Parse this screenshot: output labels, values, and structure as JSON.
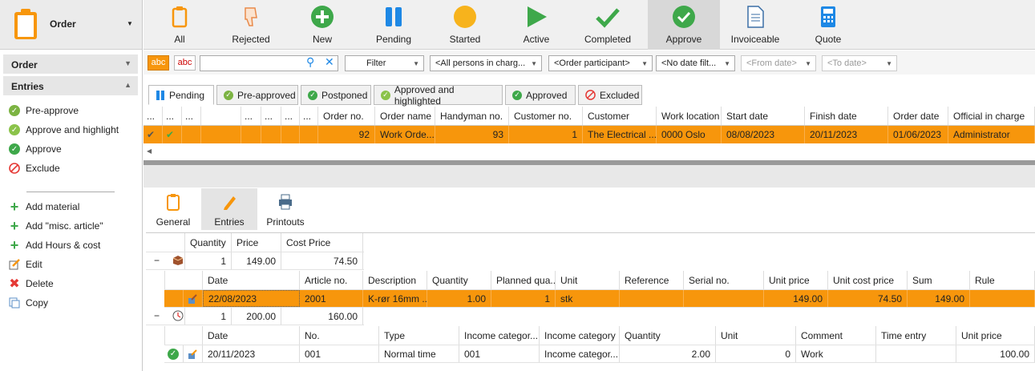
{
  "app": {
    "title": "Order"
  },
  "sidebar": {
    "sections": [
      "Order",
      "Entries"
    ],
    "group1": [
      "Pre-approve",
      "Approve and highlight",
      "Approve",
      "Exclude"
    ],
    "group2": [
      "Add material",
      "Add \"misc. article\"",
      "Add Hours & cost",
      "Edit",
      "Delete",
      "Copy"
    ]
  },
  "toolbar": [
    "All",
    "Rejected",
    "New",
    "Pending",
    "Started",
    "Active",
    "Completed",
    "Approve",
    "Invoiceable",
    "Quote"
  ],
  "filters": {
    "abc1": "abc",
    "abc2": "abc",
    "search": "",
    "filter": "Filter",
    "persons": "<All persons in charg...",
    "participant": "<Order participant>",
    "date_filter": "<No date filt...",
    "from_date": "<From date>",
    "to_date": "<To date>"
  },
  "tabs": [
    "Pending",
    "Pre-approved",
    "Postponed",
    "Approved and highlighted",
    "Approved",
    "Excluded"
  ],
  "orders": {
    "headers": [
      "...",
      "...",
      "...",
      "...",
      "...",
      "...",
      "...",
      "Order no.",
      "Order name",
      "Handyman no.",
      "Customer no.",
      "Customer",
      "Work location",
      "Start date",
      "Finish date",
      "Order date",
      "Official in charge"
    ],
    "row": [
      "92",
      "Work Orde...",
      "93",
      "1",
      "The Electrical ...",
      "0000 Oslo",
      "08/08/2023",
      "20/11/2023",
      "01/06/2023",
      "Administrator"
    ]
  },
  "detail_tabs": [
    "General",
    "Entries",
    "Printouts"
  ],
  "entries": {
    "headers": [
      "Quantity",
      "Price",
      "Cost Price"
    ],
    "material": {
      "quantity": "1",
      "price": "149.00",
      "cost": "74.50"
    },
    "material_headers": [
      "Date",
      "Article no.",
      "Description",
      "Quantity",
      "Planned qua...",
      "Unit",
      "Reference",
      "Serial no.",
      "Unit price",
      "Unit cost price",
      "Sum",
      "Rule"
    ],
    "material_row": [
      "22/08/2023",
      "2001",
      "K-rør 16mm ...",
      "1.00",
      "1",
      "stk",
      "",
      "",
      "149.00",
      "74.50",
      "149.00",
      ""
    ],
    "hours": {
      "quantity": "1",
      "price": "200.00",
      "cost": "160.00"
    },
    "hours_headers": [
      "Date",
      "No.",
      "Type",
      "Income categor...",
      "Income category",
      "Quantity",
      "Unit",
      "Comment",
      "Time entry",
      "Unit price"
    ],
    "hours_row": [
      "20/11/2023",
      "001",
      "Normal time",
      "001",
      "Income categor...",
      "2.00",
      "0",
      "Work",
      "",
      "100.00"
    ]
  }
}
